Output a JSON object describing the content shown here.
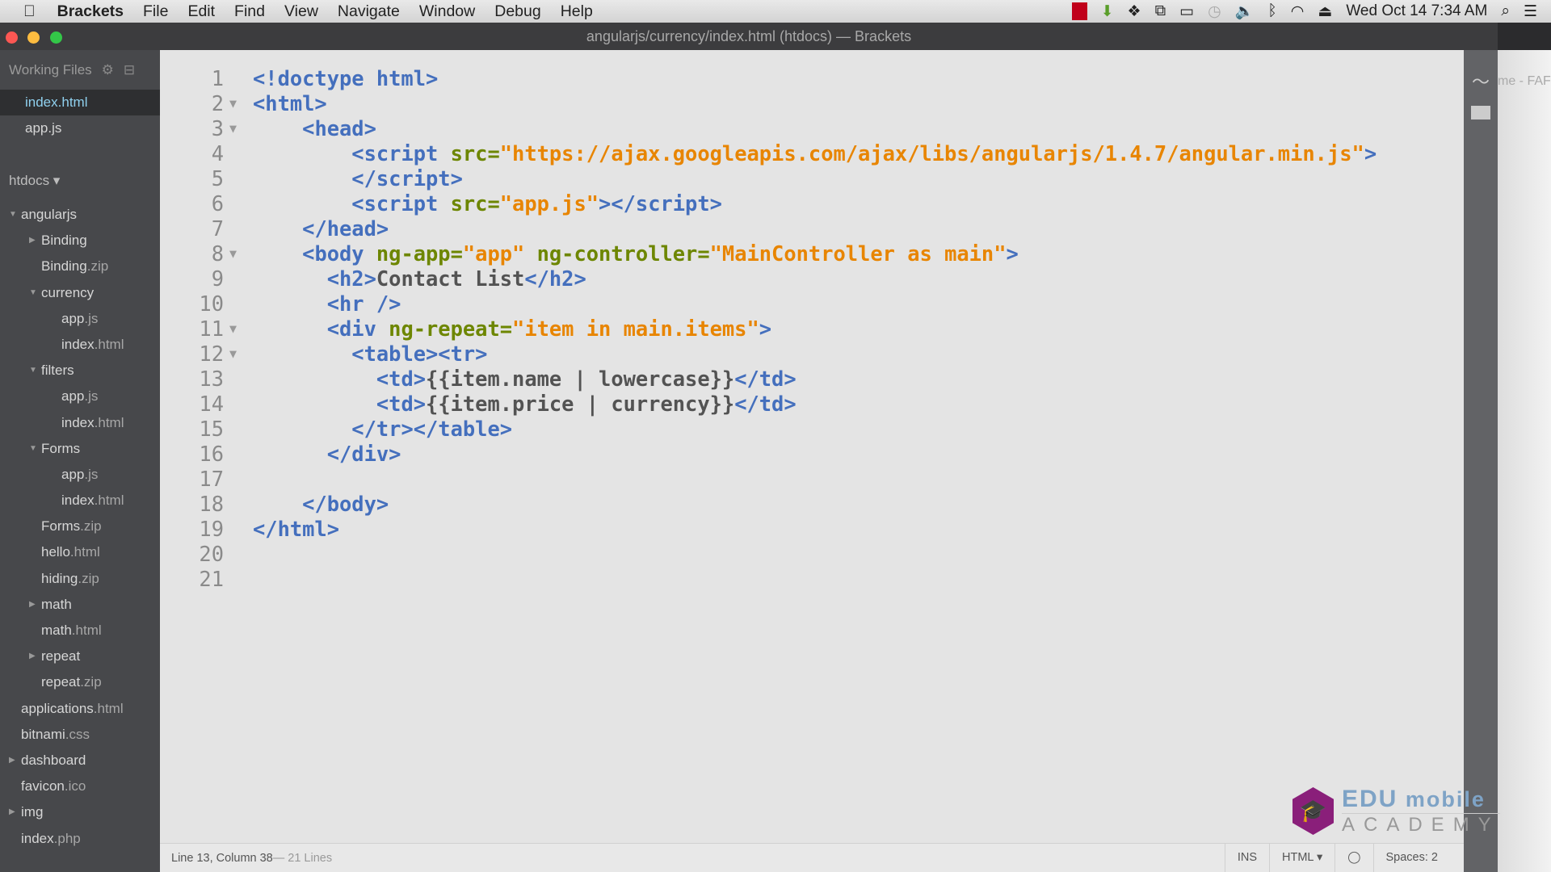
{
  "menubar": {
    "app": "Brackets",
    "items": [
      "File",
      "Edit",
      "Find",
      "View",
      "Navigate",
      "Window",
      "Debug",
      "Help"
    ],
    "clock": "Wed Oct 14  7:34 AM"
  },
  "window": {
    "title": "angularjs/currency/index.html (htdocs) — Brackets"
  },
  "sidebar": {
    "working_files_label": "Working Files",
    "working_files": [
      {
        "name": "index.html",
        "selected": true
      },
      {
        "name": "app.js",
        "selected": false
      }
    ],
    "project": "htdocs ▾",
    "tree": [
      {
        "name": "angularjs",
        "ext": "",
        "level": 0,
        "arrow": "open"
      },
      {
        "name": "Binding",
        "ext": "",
        "level": 1,
        "arrow": "closed"
      },
      {
        "name": "Binding",
        "ext": ".zip",
        "level": 1,
        "arrow": ""
      },
      {
        "name": "currency",
        "ext": "",
        "level": 1,
        "arrow": "open"
      },
      {
        "name": "app",
        "ext": ".js",
        "level": 2,
        "arrow": ""
      },
      {
        "name": "index",
        "ext": ".html",
        "level": 2,
        "arrow": ""
      },
      {
        "name": "filters",
        "ext": "",
        "level": 1,
        "arrow": "open"
      },
      {
        "name": "app",
        "ext": ".js",
        "level": 2,
        "arrow": ""
      },
      {
        "name": "index",
        "ext": ".html",
        "level": 2,
        "arrow": ""
      },
      {
        "name": "Forms",
        "ext": "",
        "level": 1,
        "arrow": "open"
      },
      {
        "name": "app",
        "ext": ".js",
        "level": 2,
        "arrow": ""
      },
      {
        "name": "index",
        "ext": ".html",
        "level": 2,
        "arrow": ""
      },
      {
        "name": "Forms",
        "ext": ".zip",
        "level": 1,
        "arrow": ""
      },
      {
        "name": "hello",
        "ext": ".html",
        "level": 1,
        "arrow": ""
      },
      {
        "name": "hiding",
        "ext": ".zip",
        "level": 1,
        "arrow": ""
      },
      {
        "name": "math",
        "ext": "",
        "level": 1,
        "arrow": "closed"
      },
      {
        "name": "math",
        "ext": ".html",
        "level": 1,
        "arrow": ""
      },
      {
        "name": "repeat",
        "ext": "",
        "level": 1,
        "arrow": "closed"
      },
      {
        "name": "repeat",
        "ext": ".zip",
        "level": 1,
        "arrow": ""
      },
      {
        "name": "applications",
        "ext": ".html",
        "level": 0,
        "arrow": ""
      },
      {
        "name": "bitnami",
        "ext": ".css",
        "level": 0,
        "arrow": ""
      },
      {
        "name": "dashboard",
        "ext": "",
        "level": 0,
        "arrow": "closed"
      },
      {
        "name": "favicon",
        "ext": ".ico",
        "level": 0,
        "arrow": ""
      },
      {
        "name": "img",
        "ext": "",
        "level": 0,
        "arrow": "closed"
      },
      {
        "name": "index",
        "ext": ".php",
        "level": 0,
        "arrow": ""
      }
    ]
  },
  "editor": {
    "lines": [
      {
        "n": "1",
        "fold": false,
        "tokens": [
          [
            "tag",
            "<!doctype html>"
          ]
        ]
      },
      {
        "n": "2",
        "fold": true,
        "tokens": [
          [
            "tag",
            "<html>"
          ]
        ]
      },
      {
        "n": "3",
        "fold": true,
        "tokens": [
          [
            "txt",
            "    "
          ],
          [
            "tag",
            "<head>"
          ]
        ]
      },
      {
        "n": "4",
        "fold": false,
        "tokens": [
          [
            "txt",
            "        "
          ],
          [
            "tag",
            "<script "
          ],
          [
            "attr",
            "src="
          ],
          [
            "str",
            "\"https://ajax.googleapis.com/ajax/libs/angularjs/1.4.7/angular.min.js\""
          ],
          [
            "tag",
            ">"
          ]
        ]
      },
      {
        "n": "5",
        "fold": false,
        "tokens": [
          [
            "txt",
            "        "
          ],
          [
            "tag",
            "</script>"
          ]
        ]
      },
      {
        "n": "6",
        "fold": false,
        "tokens": [
          [
            "txt",
            "        "
          ],
          [
            "tag",
            "<script "
          ],
          [
            "attr",
            "src="
          ],
          [
            "str",
            "\"app.js\""
          ],
          [
            "tag",
            "></script>"
          ]
        ]
      },
      {
        "n": "7",
        "fold": false,
        "tokens": [
          [
            "txt",
            "    "
          ],
          [
            "tag",
            "</head>"
          ]
        ]
      },
      {
        "n": "8",
        "fold": true,
        "tokens": [
          [
            "txt",
            "    "
          ],
          [
            "tag",
            "<body "
          ],
          [
            "attr",
            "ng-app="
          ],
          [
            "str",
            "\"app\""
          ],
          [
            "attr",
            " ng-controller="
          ],
          [
            "str",
            "\"MainController as main\""
          ],
          [
            "tag",
            ">"
          ]
        ]
      },
      {
        "n": "9",
        "fold": false,
        "tokens": [
          [
            "txt",
            "      "
          ],
          [
            "tag",
            "<h2>"
          ],
          [
            "txt",
            "Contact List"
          ],
          [
            "tag",
            "</h2>"
          ]
        ]
      },
      {
        "n": "10",
        "fold": false,
        "tokens": [
          [
            "txt",
            "      "
          ],
          [
            "tag",
            "<hr />"
          ]
        ]
      },
      {
        "n": "11",
        "fold": true,
        "tokens": [
          [
            "txt",
            "      "
          ],
          [
            "tag",
            "<div "
          ],
          [
            "attr",
            "ng-repeat="
          ],
          [
            "str",
            "\"item in main.items\""
          ],
          [
            "tag",
            ">"
          ]
        ]
      },
      {
        "n": "12",
        "fold": true,
        "tokens": [
          [
            "txt",
            "        "
          ],
          [
            "tag",
            "<table><tr>"
          ]
        ]
      },
      {
        "n": "13",
        "fold": false,
        "tokens": [
          [
            "txt",
            "          "
          ],
          [
            "tag",
            "<td>"
          ],
          [
            "txt",
            "{{item.name | lowercase}}"
          ],
          [
            "tag",
            "</td>"
          ]
        ]
      },
      {
        "n": "14",
        "fold": false,
        "tokens": [
          [
            "txt",
            "          "
          ],
          [
            "tag",
            "<td>"
          ],
          [
            "txt",
            "{{item.price | currency}}"
          ],
          [
            "tag",
            "</td>"
          ]
        ]
      },
      {
        "n": "15",
        "fold": false,
        "tokens": [
          [
            "txt",
            "        "
          ],
          [
            "tag",
            "</tr></table>"
          ]
        ]
      },
      {
        "n": "16",
        "fold": false,
        "tokens": [
          [
            "txt",
            "      "
          ],
          [
            "tag",
            "</div>"
          ]
        ]
      },
      {
        "n": "17",
        "fold": false,
        "tokens": []
      },
      {
        "n": "18",
        "fold": false,
        "tokens": [
          [
            "txt",
            "    "
          ],
          [
            "tag",
            "</body>"
          ]
        ]
      },
      {
        "n": "19",
        "fold": false,
        "tokens": [
          [
            "tag",
            "</html>"
          ]
        ]
      },
      {
        "n": "20",
        "fold": false,
        "tokens": []
      },
      {
        "n": "21",
        "fold": false,
        "tokens": []
      }
    ]
  },
  "statusbar": {
    "position": "Line 13, Column 38",
    "lines": " — 21 Lines",
    "mode": "INS",
    "language": "HTML ▾",
    "spaces": "Spaces: 2"
  },
  "background_text": "me - FAF",
  "watermark": {
    "line1a": "EDU",
    "line1b": " mobile",
    "line2": "ACADEMY"
  },
  "colors": {
    "tag": "#446fbd",
    "attr": "#6d8600",
    "string": "#e88501",
    "text": "#535353",
    "selected_file": "#8fd0ee"
  }
}
